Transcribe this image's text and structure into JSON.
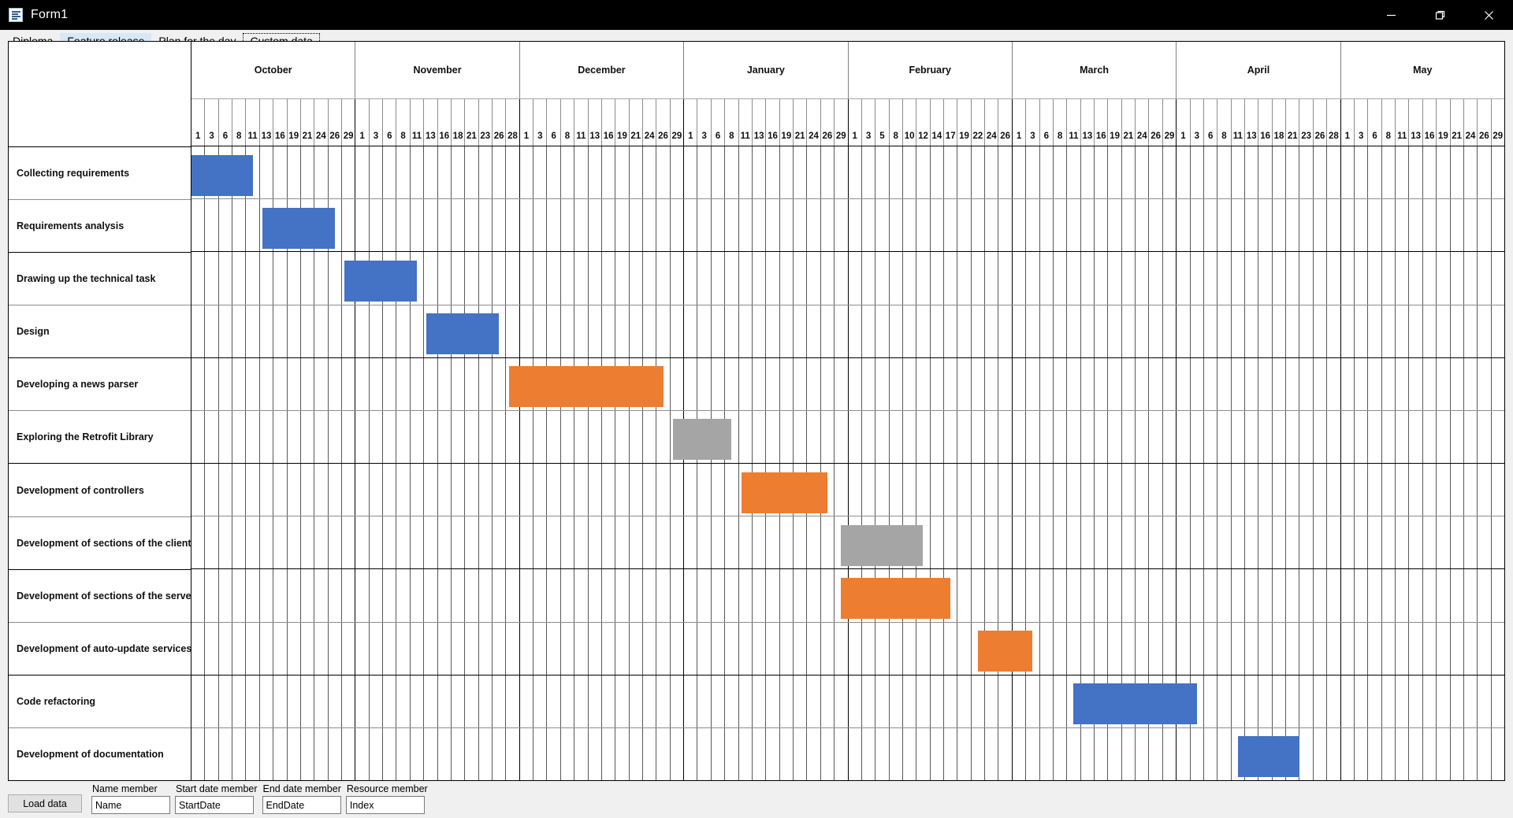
{
  "window": {
    "title": "Form1",
    "icon": "form-designer-icon",
    "controls": [
      {
        "name": "minimize",
        "glyph": "minimize-icon"
      },
      {
        "name": "maximize",
        "glyph": "maximize-icon"
      },
      {
        "name": "close",
        "glyph": "close-icon"
      }
    ]
  },
  "tabs": [
    {
      "label": "Diploma",
      "state": "normal"
    },
    {
      "label": "Feature release",
      "state": "hover"
    },
    {
      "label": "Plan for the day",
      "state": "normal"
    },
    {
      "label": "Custom data",
      "state": "selected"
    }
  ],
  "colors": {
    "blue": "#4472C4",
    "orange": "#ED7D31",
    "gray": "#A5A5A5",
    "grid_light": "#8C8C8C",
    "grid_dark": "#000000",
    "tab_hover": "#D7E8F7"
  },
  "chart_data": {
    "type": "bar",
    "title": "",
    "xlabel": "",
    "ylabel": "",
    "orientation": "horizontal-gantt",
    "grid": true,
    "legend": "none",
    "months": [
      {
        "name": "October",
        "days": [
          1,
          3,
          6,
          8,
          11,
          13,
          16,
          19,
          21,
          24,
          26,
          29
        ]
      },
      {
        "name": "November",
        "days": [
          1,
          3,
          6,
          8,
          11,
          13,
          16,
          18,
          21,
          23,
          26,
          28
        ]
      },
      {
        "name": "December",
        "days": [
          1,
          3,
          6,
          8,
          11,
          13,
          16,
          19,
          21,
          24,
          26,
          29
        ]
      },
      {
        "name": "January",
        "days": [
          1,
          3,
          6,
          8,
          11,
          13,
          16,
          19,
          21,
          24,
          26,
          29
        ]
      },
      {
        "name": "February",
        "days": [
          1,
          3,
          5,
          8,
          10,
          12,
          14,
          17,
          19,
          22,
          24,
          26
        ]
      },
      {
        "name": "March",
        "days": [
          1,
          3,
          6,
          8,
          11,
          13,
          16,
          19,
          21,
          24,
          26,
          29
        ]
      },
      {
        "name": "April",
        "days": [
          1,
          3,
          6,
          8,
          11,
          13,
          16,
          18,
          21,
          23,
          26,
          28
        ]
      },
      {
        "name": "May",
        "days": [
          1,
          3,
          6,
          8,
          11,
          13,
          16,
          19,
          21,
          24,
          26,
          29
        ]
      }
    ],
    "categories": [
      "Collecting requirements",
      "Requirements analysis",
      "Drawing up the technical task",
      "Design",
      "Developing a news parser",
      "Exploring the Retrofit Library",
      "Development of controllers",
      "Development of sections of the client side",
      "Development of sections of the server side",
      "Development of auto-update services",
      "Code refactoring",
      "Development of documentation"
    ],
    "tasks": [
      {
        "name": "Collecting requirements",
        "resource": "blue",
        "start_month": "October",
        "start_tick": 0,
        "end_month": "October",
        "end_tick": 5,
        "start_slot": 0.0,
        "end_slot": 4.5
      },
      {
        "name": "Requirements analysis",
        "resource": "blue",
        "start_month": "October",
        "start_tick": 5,
        "end_month": "October",
        "end_tick": 11,
        "start_slot": 5.2,
        "end_slot": 10.5
      },
      {
        "name": "Drawing up the technical task",
        "resource": "blue",
        "start_month": "November",
        "start_tick": 0,
        "end_month": "November",
        "end_tick": 5,
        "start_slot": 11.2,
        "end_slot": 16.5
      },
      {
        "name": "Design",
        "resource": "blue",
        "start_month": "November",
        "start_tick": 6,
        "end_month": "November",
        "end_tick": 11,
        "start_slot": 17.2,
        "end_slot": 22.5
      },
      {
        "name": "Developing a news parser",
        "resource": "orange",
        "start_month": "December",
        "start_tick": 0,
        "end_month": "December",
        "end_tick": 11,
        "start_slot": 23.2,
        "end_slot": 34.5
      },
      {
        "name": "Exploring the Retrofit Library",
        "resource": "gray",
        "start_month": "January",
        "start_tick": 0,
        "end_month": "January",
        "end_tick": 4,
        "start_slot": 35.2,
        "end_slot": 39.5
      },
      {
        "name": "Development of controllers",
        "resource": "orange",
        "start_month": "January",
        "start_tick": 5,
        "end_month": "January",
        "end_tick": 11,
        "start_slot": 40.2,
        "end_slot": 46.5
      },
      {
        "name": "Development of sections of the client side",
        "resource": "gray",
        "start_month": "February",
        "start_tick": 1,
        "end_month": "February",
        "end_tick": 8,
        "start_slot": 47.5,
        "end_slot": 53.5
      },
      {
        "name": "Development of sections of the server side",
        "resource": "orange",
        "start_month": "February",
        "start_tick": 1,
        "end_month": "February",
        "end_tick": 11,
        "start_slot": 47.5,
        "end_slot": 55.5
      },
      {
        "name": "Development of auto-update services",
        "resource": "orange",
        "start_month": "March",
        "start_tick": 1,
        "end_month": "March",
        "end_tick": 5,
        "start_slot": 57.5,
        "end_slot": 61.5
      },
      {
        "name": "Code refactoring",
        "resource": "blue",
        "start_month": "March",
        "start_tick": 8,
        "end_month": "April",
        "end_tick": 7,
        "start_slot": 64.5,
        "end_slot": 73.5
      },
      {
        "name": "Development of documentation",
        "resource": "blue",
        "start_month": "April",
        "start_tick": 9,
        "end_month": "May",
        "end_tick": 1,
        "start_slot": 76.5,
        "end_slot": 81.0
      }
    ]
  },
  "footer": {
    "load_button": "Load data",
    "fields": [
      {
        "label": "Name member",
        "value": "Name"
      },
      {
        "label": "Start date member",
        "value": "StartDate"
      },
      {
        "label": "End date member",
        "value": "EndDate"
      },
      {
        "label": "Resource member",
        "value": "Index"
      }
    ]
  }
}
